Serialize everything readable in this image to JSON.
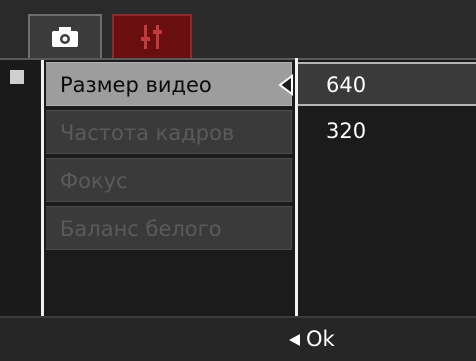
{
  "tabs": [
    {
      "icon": "camera-icon",
      "active": true
    },
    {
      "icon": "setup-icon",
      "active": false
    }
  ],
  "menu": {
    "items": [
      {
        "label": "Размер видео",
        "selected": true
      },
      {
        "label": "Частота кадров",
        "selected": false
      },
      {
        "label": "Фокус",
        "selected": false
      },
      {
        "label": "Баланс белого",
        "selected": false
      }
    ]
  },
  "options": {
    "items": [
      {
        "label": "640",
        "selected": true
      },
      {
        "label": "320",
        "selected": false
      }
    ]
  },
  "footer": {
    "ok_label": "Ok",
    "ok_icon": "triangle-left-icon"
  },
  "colors": {
    "selected_item_bg": "#9d9d9d",
    "setup_tab_bg": "#6a0f0f",
    "text": "#ffffff"
  }
}
